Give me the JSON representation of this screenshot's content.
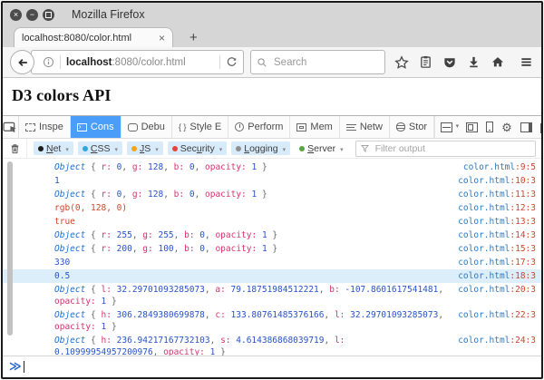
{
  "window": {
    "title": "Mozilla Firefox",
    "controls": [
      "close",
      "minimize",
      "maximize"
    ]
  },
  "tab": {
    "title": "localhost:8080/color.html",
    "new_tab_label": "+"
  },
  "navbar": {
    "url_host": "localhost",
    "url_rest": ":8080/color.html",
    "search_placeholder": "Search"
  },
  "page": {
    "heading": "D3 colors API"
  },
  "devtools": {
    "tabs": [
      {
        "label": "Inspe",
        "icon": "inspector",
        "active": false
      },
      {
        "label": "Cons",
        "icon": "console",
        "active": true
      },
      {
        "label": "Debu",
        "icon": "debugger",
        "active": false
      },
      {
        "label": "Style E",
        "icon": "style-editor",
        "active": false
      },
      {
        "label": "Perform",
        "icon": "performance",
        "active": false
      },
      {
        "label": "Mem",
        "icon": "memory",
        "active": false
      },
      {
        "label": "Netw",
        "icon": "network",
        "active": false
      },
      {
        "label": "Stor",
        "icon": "storage",
        "active": false
      }
    ],
    "toolbar_icons": [
      "split-console",
      "responsive-design",
      "device",
      "settings",
      "dock-side",
      "separate-window",
      "close-devtools"
    ],
    "filters": [
      {
        "pre": "",
        "key": "N",
        "post": "et",
        "dot": "#1c1c1c",
        "active": true
      },
      {
        "pre": "",
        "key": "C",
        "post": "SS",
        "dot": "#30a6e0",
        "active": true
      },
      {
        "pre": "",
        "key": "J",
        "post": "S",
        "dot": "#f2a51a",
        "active": true
      },
      {
        "pre": "Sec",
        "key": "u",
        "post": "rity",
        "dot": "#e8433a",
        "active": true
      },
      {
        "pre": "",
        "key": "L",
        "post": "ogging",
        "dot": "#8f8f8f",
        "active": true
      },
      {
        "pre": "",
        "key": "S",
        "post": "erver",
        "dot": "#56a546",
        "active": false
      }
    ],
    "filter_placeholder": "Filter output",
    "console": {
      "prompt": "≫",
      "messages": [
        {
          "kind": "object",
          "props": [
            {
              "k": "r",
              "v": "0"
            },
            {
              "k": "g",
              "v": "128"
            },
            {
              "k": "b",
              "v": "0"
            },
            {
              "k": "opacity",
              "v": "1"
            }
          ],
          "source_file": "color.html",
          "source_pos": ":9:5",
          "highlight": false
        },
        {
          "kind": "number",
          "text": "1",
          "source_file": "color.html",
          "source_pos": ":10:3",
          "highlight": false
        },
        {
          "kind": "object",
          "props": [
            {
              "k": "r",
              "v": "0"
            },
            {
              "k": "g",
              "v": "128"
            },
            {
              "k": "b",
              "v": "0"
            },
            {
              "k": "opacity",
              "v": "1"
            }
          ],
          "source_file": "color.html",
          "source_pos": ":11:3",
          "highlight": false
        },
        {
          "kind": "string",
          "text": "rgb(0, 128, 0)",
          "source_file": "color.html",
          "source_pos": ":12:3",
          "highlight": false
        },
        {
          "kind": "string",
          "text": "true",
          "source_file": "color.html",
          "source_pos": ":13:3",
          "highlight": false
        },
        {
          "kind": "object",
          "props": [
            {
              "k": "r",
              "v": "255"
            },
            {
              "k": "g",
              "v": "255"
            },
            {
              "k": "b",
              "v": "0"
            },
            {
              "k": "opacity",
              "v": "1"
            }
          ],
          "source_file": "color.html",
          "source_pos": ":14:3",
          "highlight": false
        },
        {
          "kind": "object",
          "props": [
            {
              "k": "r",
              "v": "200"
            },
            {
              "k": "g",
              "v": "100"
            },
            {
              "k": "b",
              "v": "0"
            },
            {
              "k": "opacity",
              "v": "1"
            }
          ],
          "source_file": "color.html",
          "source_pos": ":15:3",
          "highlight": false
        },
        {
          "kind": "number",
          "text": "330",
          "source_file": "color.html",
          "source_pos": ":17:3",
          "highlight": false
        },
        {
          "kind": "number",
          "text": "0.5",
          "source_file": "color.html",
          "source_pos": ":18:3",
          "highlight": true
        },
        {
          "kind": "object",
          "props": [
            {
              "k": "l",
              "v": "32.29701093285073"
            },
            {
              "k": "a",
              "v": "79.18751984512221"
            },
            {
              "k": "b",
              "v": "-107.8601617541481"
            },
            {
              "k": "opacity",
              "v": "1"
            }
          ],
          "source_file": "color.html",
          "source_pos": ":20:3",
          "highlight": false
        },
        {
          "kind": "object",
          "props": [
            {
              "k": "h",
              "v": "306.2849380699878"
            },
            {
              "k": "c",
              "v": "133.80761485376166"
            },
            {
              "k": "l",
              "v": "32.29701093285073"
            },
            {
              "k": "opacity",
              "v": "1"
            }
          ],
          "source_file": "color.html",
          "source_pos": ":22:3",
          "highlight": false
        },
        {
          "kind": "object",
          "props": [
            {
              "k": "h",
              "v": "236.94217167732103"
            },
            {
              "k": "s",
              "v": "4.614386868039719"
            },
            {
              "k": "l",
              "v": "0.10999954957200976"
            },
            {
              "k": "opacity",
              "v": "1"
            }
          ],
          "source_file": "color.html",
          "source_pos": ":24:3",
          "highlight": false
        }
      ]
    }
  },
  "colors": {
    "devtools_active_tab": "#4a9df8",
    "console_object": "#1f6fd0",
    "console_property": "#d6336c",
    "console_number": "#2953c9",
    "console_string": "#d0452b",
    "source_link_file": "#2a79c0",
    "source_link_pos": "#d0452b",
    "highlight_row": "#ddeefb",
    "filter_pill_bg": "#d8ebfa"
  }
}
